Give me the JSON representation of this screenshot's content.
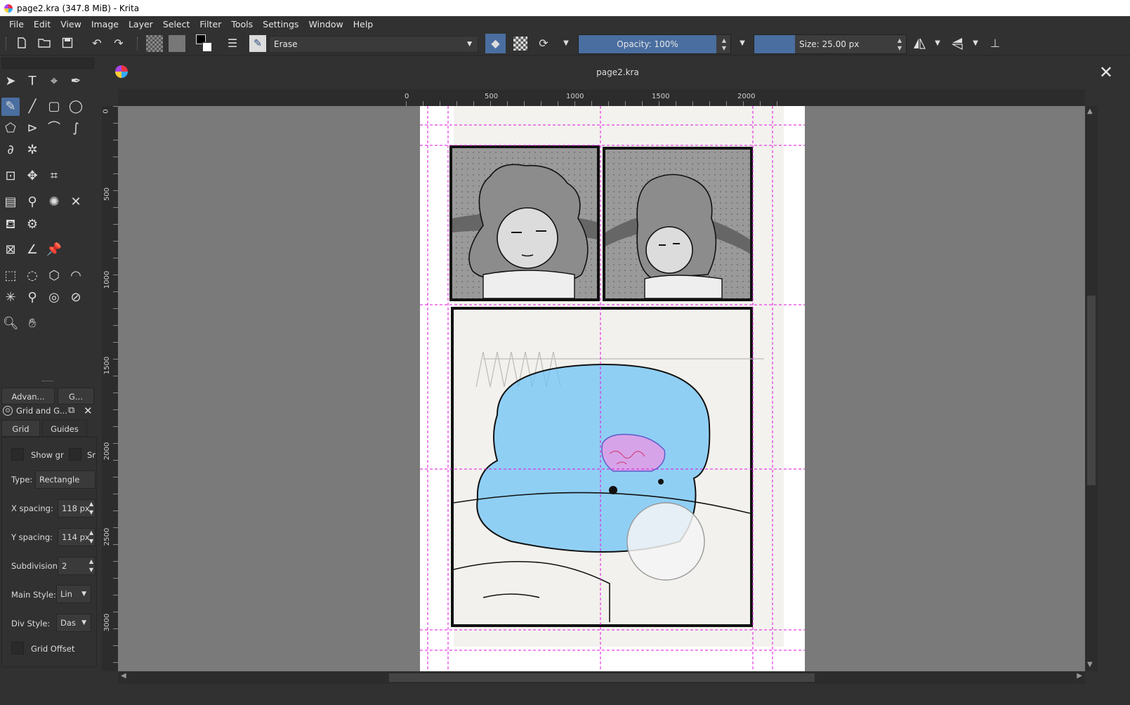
{
  "window": {
    "title": "page2.kra (347.8 MiB)  - Krita"
  },
  "menu": [
    "File",
    "Edit",
    "View",
    "Image",
    "Layer",
    "Select",
    "Filter",
    "Tools",
    "Settings",
    "Window",
    "Help"
  ],
  "toolbar": {
    "blend_mode": "Erase",
    "opacity_label": "Opacity: 100%",
    "opacity_value": 1.0,
    "size_label": "Size: 25.00 px"
  },
  "document": {
    "tab_title": "page2.kra"
  },
  "rulers": {
    "top": [
      "0",
      "500",
      "1000",
      "1500",
      "2000"
    ],
    "left": [
      "0",
      "500",
      "1000",
      "1500",
      "2000",
      "2500",
      "3000"
    ]
  },
  "docker": {
    "top_tabs": [
      "Advan...",
      "G..."
    ],
    "title": "Grid and G...",
    "tabs": [
      "Grid",
      "Guides"
    ],
    "show_grid_label": "Show gr",
    "snap_label": "Sr",
    "type_label": "Type:",
    "type_value": "Rectangle",
    "x_spacing_label": "X spacing:",
    "x_spacing_value": "118 px",
    "y_spacing_label": "Y spacing:",
    "y_spacing_value": "114 px",
    "subdivision_label": "Subdivision",
    "subdivision_value": "2",
    "main_style_label": "Main Style:",
    "main_style_value": "Lin",
    "div_style_label": "Div Style:",
    "div_style_value": "Das",
    "grid_offset_label": "Grid Offset"
  },
  "colors": {
    "accent": "#4a6ea0",
    "guide": "#e010e0",
    "blob": "#6fc3f5"
  }
}
